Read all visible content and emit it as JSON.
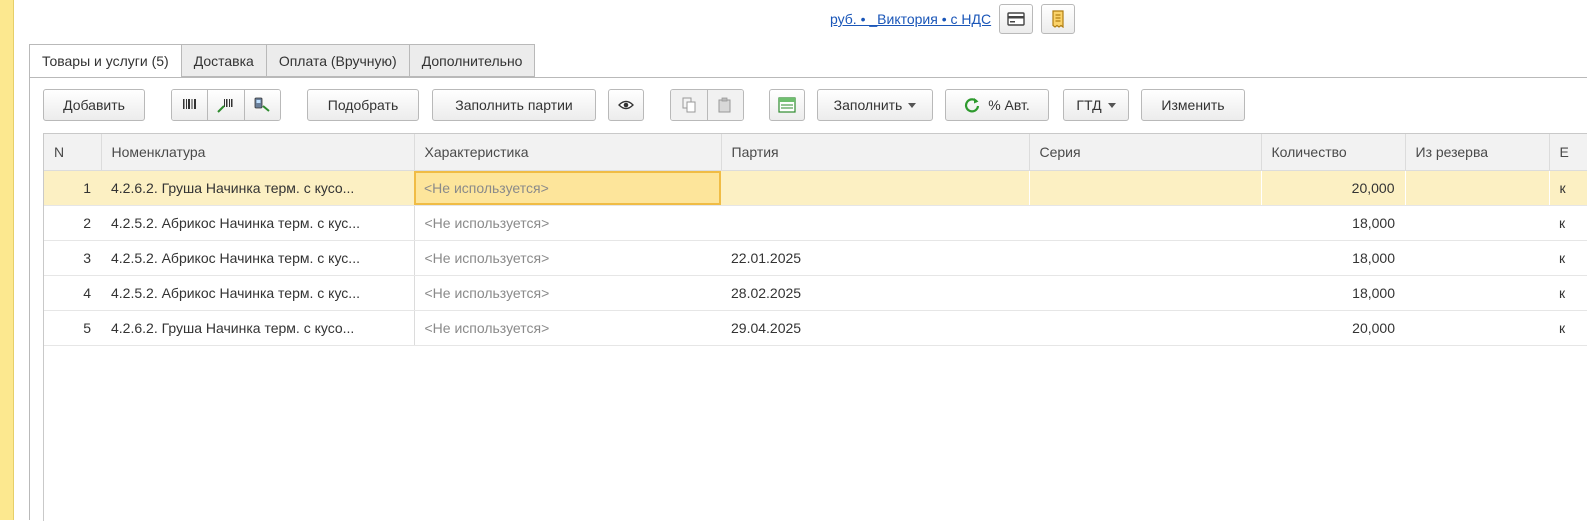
{
  "header": {
    "link_text": "руб. • _Виктория • с НДС",
    "button1_icon": "card-icon",
    "button2_icon": "receipt-icon"
  },
  "tabs": [
    {
      "label": "Товары и услуги (5)",
      "active": true
    },
    {
      "label": "Доставка"
    },
    {
      "label": "Оплата (Вручную)"
    },
    {
      "label": "Дополнительно"
    }
  ],
  "toolbar": {
    "add": "Добавить",
    "select": "Подобрать",
    "fill_batches": "Заполнить партии",
    "fill": "Заполнить",
    "auto_percent": "% Авт.",
    "gtd": "ГТД",
    "change": "Изменить",
    "icons": [
      "barcode-icon",
      "barcode-scan-icon",
      "barcode-scanner-icon",
      "eye-icon",
      "copy-icon",
      "paste-icon",
      "fill-table-icon",
      "refresh-icon"
    ]
  },
  "table": {
    "columns": [
      "N",
      "Номенклатура",
      "Характеристика",
      "Партия",
      "Серия",
      "Количество",
      "Из резерва",
      "Е"
    ],
    "rows": [
      {
        "n": "1",
        "item": "4.2.6.2. Груша Начинка терм. с кусо...",
        "char": "<Не используется>",
        "batch": "",
        "series": "",
        "qty": "20,000",
        "reserve": "",
        "unit": "к"
      },
      {
        "n": "2",
        "item": "4.2.5.2. Абрикос Начинка терм. с кус...",
        "char": "<Не используется>",
        "batch": "",
        "series": "",
        "qty": "18,000",
        "reserve": "",
        "unit": "к"
      },
      {
        "n": "3",
        "item": "4.2.5.2. Абрикос Начинка терм. с кус...",
        "char": "<Не используется>",
        "batch": "22.01.2025",
        "series": "",
        "qty": "18,000",
        "reserve": "",
        "unit": "к"
      },
      {
        "n": "4",
        "item": "4.2.5.2. Абрикос Начинка терм. с кус...",
        "char": "<Не используется>",
        "batch": "28.02.2025",
        "series": "",
        "qty": "18,000",
        "reserve": "",
        "unit": "к"
      },
      {
        "n": "5",
        "item": "4.2.6.2. Груша Начинка терм. с кусо...",
        "char": "<Не используется>",
        "batch": "29.04.2025",
        "series": "",
        "qty": "20,000",
        "reserve": "",
        "unit": "к"
      }
    ]
  },
  "colors": {
    "accent": "#f0bc45",
    "selected_row": "#fcf0c3",
    "strip": "#fce88f",
    "link": "#1a56b8"
  }
}
